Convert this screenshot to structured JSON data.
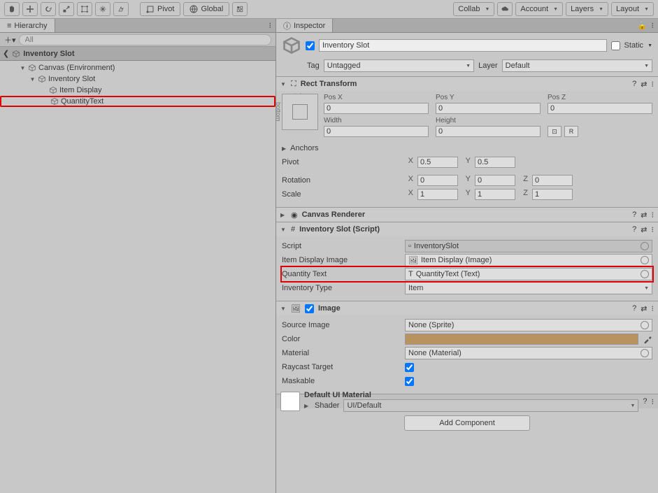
{
  "toolbar": {
    "pivot": "Pivot",
    "global": "Global",
    "collab": "Collab",
    "account": "Account",
    "layers": "Layers",
    "layout": "Layout"
  },
  "hierarchy": {
    "tab": "Hierarchy",
    "search_ph": "All",
    "crumb_icon": "❮",
    "crumb": "Inventory Slot",
    "items": {
      "canvas": "Canvas (Environment)",
      "slot": "Inventory Slot",
      "item_display": "Item Display",
      "quantity": "QuantityText"
    }
  },
  "inspector": {
    "tab": "Inspector",
    "name": "Inventory Slot",
    "static": "Static",
    "tag_lbl": "Tag",
    "tag_val": "Untagged",
    "layer_lbl": "Layer",
    "layer_val": "Default",
    "rect": {
      "title": "Rect Transform",
      "anchor_top": "left",
      "anchor_side": "bottom",
      "posx": "Pos X",
      "posy": "Pos Y",
      "posz": "Pos Z",
      "width": "Width",
      "height": "Height",
      "vx": "0",
      "vy": "0",
      "vz": "0",
      "vw": "0",
      "vh": "0",
      "anchors": "Anchors",
      "pivot": "Pivot",
      "px": "0.5",
      "py": "0.5",
      "rotation": "Rotation",
      "rx": "0",
      "ry": "0",
      "rz": "0",
      "scale": "Scale",
      "sx": "1",
      "sy": "1",
      "sz": "1",
      "R": "R"
    },
    "canvasr": {
      "title": "Canvas Renderer"
    },
    "script": {
      "title": "Inventory Slot (Script)",
      "script_lbl": "Script",
      "script_val": "InventorySlot",
      "img_lbl": "Item Display Image",
      "img_val": "Item Display (Image)",
      "qty_lbl": "Quantity Text",
      "qty_val": "QuantityText (Text)",
      "type_lbl": "Inventory Type",
      "type_val": "Item"
    },
    "image": {
      "title": "Image",
      "src_lbl": "Source Image",
      "src_val": "None (Sprite)",
      "color_lbl": "Color",
      "mat_lbl": "Material",
      "mat_val": "None (Material)",
      "ray_lbl": "Raycast Target",
      "mask_lbl": "Maskable",
      "color": "#b89360"
    },
    "material": {
      "title": "Default UI Material",
      "shader_lbl": "Shader",
      "shader_val": "UI/Default"
    },
    "add": "Add Component"
  }
}
